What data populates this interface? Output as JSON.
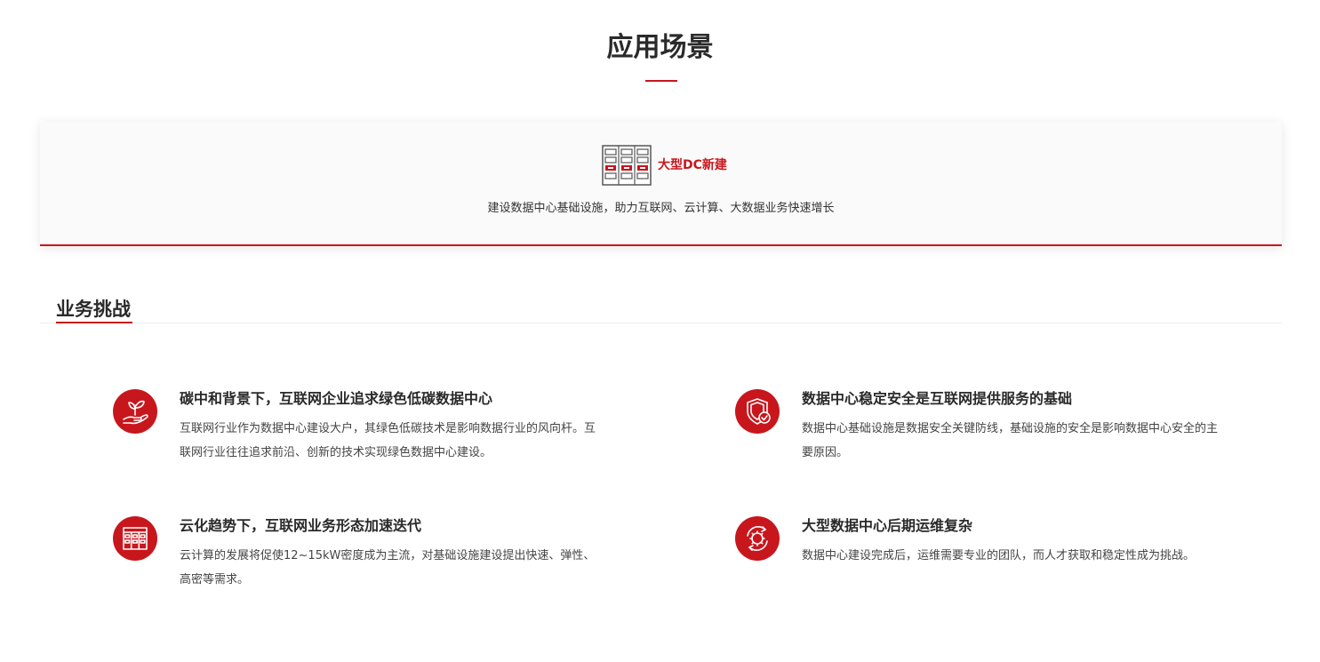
{
  "page": {
    "title": "应用场景"
  },
  "scenario": {
    "icon": "server-rack-icon",
    "name": "大型DC新建",
    "description": "建设数据中心基础设施，助力互联网、云计算、大数据业务快速增长"
  },
  "challenges_section": {
    "title": "业务挑战",
    "items": [
      {
        "icon": "plant-in-hand-icon",
        "title": "碳中和背景下，互联网企业追求绿色低碳数据中心",
        "description": "互联网行业作为数据中心建设大户，其绿色低碳技术是影响数据行业的风向杆。互联网行业往往追求前沿、创新的技术实现绿色数据中心建设。"
      },
      {
        "icon": "shield-check-icon",
        "title": "数据中心稳定安全是互联网提供服务的基础",
        "description": "数据中心基础设施是数据安全关键防线，基础设施的安全是影响数据中心安全的主要原因。"
      },
      {
        "icon": "cabinet-grid-icon",
        "title": "云化趋势下，互联网业务形态加速迭代",
        "description": "云计算的发展将促使12~15kW密度成为主流，对基础设施建设提出快速、弹性、高密等需求。"
      },
      {
        "icon": "gear-cycle-icon",
        "title": "大型数据中心后期运维复杂",
        "description": "数据中心建设完成后，运维需要专业的团队，而人才获取和稳定性成为挑战。"
      }
    ]
  },
  "colors": {
    "accent": "#c8161d",
    "card_bg": "#fafafa",
    "text": "#333333"
  }
}
